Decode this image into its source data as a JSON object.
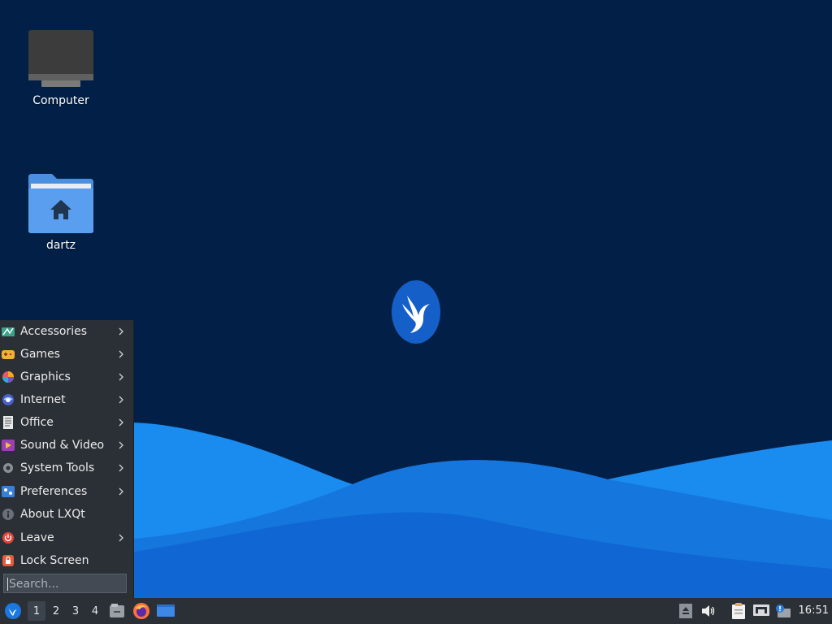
{
  "desktop": {
    "icons": [
      {
        "label": "Computer",
        "icon": "computer-icon"
      },
      {
        "label": "dartz",
        "icon": "home-folder-icon"
      }
    ],
    "logo": "lubuntu-logo-icon",
    "colors": {
      "background": "#022047",
      "wave_light": "#1a8cf0",
      "wave_mid": "#1576de",
      "wave_dark": "#0a57c5"
    }
  },
  "start_menu": {
    "items": [
      {
        "label": "Accessories",
        "icon": "accessories-icon",
        "submenu": true
      },
      {
        "label": "Games",
        "icon": "games-icon",
        "submenu": true
      },
      {
        "label": "Graphics",
        "icon": "graphics-icon",
        "submenu": true
      },
      {
        "label": "Internet",
        "icon": "internet-icon",
        "submenu": true
      },
      {
        "label": "Office",
        "icon": "office-icon",
        "submenu": true
      },
      {
        "label": "Sound & Video",
        "icon": "sound-video-icon",
        "submenu": true
      },
      {
        "label": "System Tools",
        "icon": "system-tools-icon",
        "submenu": true
      },
      {
        "label": "Preferences",
        "icon": "preferences-icon",
        "submenu": true
      },
      {
        "label": "About LXQt",
        "icon": "info-icon",
        "submenu": false
      },
      {
        "label": "Leave",
        "icon": "power-icon",
        "submenu": true
      },
      {
        "label": "Lock Screen",
        "icon": "lock-icon",
        "submenu": false
      }
    ],
    "search_placeholder": "Search..."
  },
  "taskbar": {
    "start_icon": "lubuntu-start-icon",
    "workspaces": [
      "1",
      "2",
      "3",
      "4"
    ],
    "active_workspace": "1",
    "quicklaunch": [
      "file-manager-icon",
      "firefox-icon",
      "show-desktop-icon"
    ],
    "tray": [
      "removable-media-icon",
      "volume-icon",
      "clipboard-icon",
      "network-icon",
      "update-notifier-icon"
    ],
    "clock": "16:51"
  }
}
